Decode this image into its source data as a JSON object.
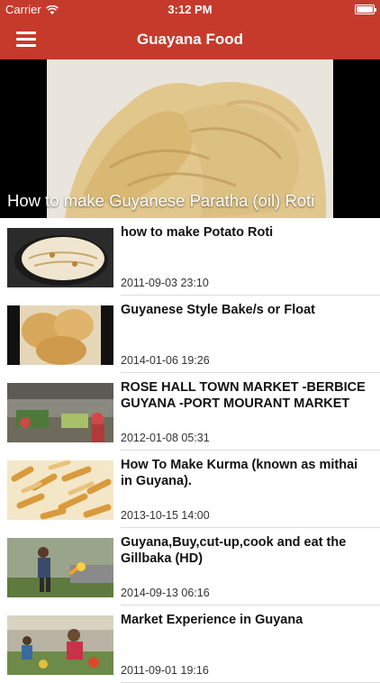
{
  "status_bar": {
    "carrier": "Carrier",
    "wifi_icon": "wifi-icon",
    "time": "3:12 PM",
    "battery_icon": "battery-icon",
    "battery_level": 1.0
  },
  "nav": {
    "title": "Guayana Food",
    "menu_icon": "hamburger-menu-icon",
    "color": "#c63a2c"
  },
  "featured": {
    "title": "How to make Guyanese Paratha (oil) Roti"
  },
  "videos": [
    {
      "title": "how to make Potato Roti",
      "date": "2011-09-03 23:10"
    },
    {
      "title": "Guyanese Style Bake/s or Float",
      "date": "2014-01-06 19:26"
    },
    {
      "title": "ROSE HALL TOWN MARKET -BERBICE GUYANA -PORT MOURANT MARKET",
      "date": "2012-01-08 05:31"
    },
    {
      "title": "How To Make Kurma (known as mithai in Guyana).",
      "date": "2013-10-15 14:00"
    },
    {
      "title": "Guyana,Buy,cut-up,cook and eat the Gillbaka (HD)",
      "date": "2014-09-13 06:16"
    },
    {
      "title": "Market Experience in Guyana",
      "date": "2011-09-01 19:16"
    }
  ]
}
